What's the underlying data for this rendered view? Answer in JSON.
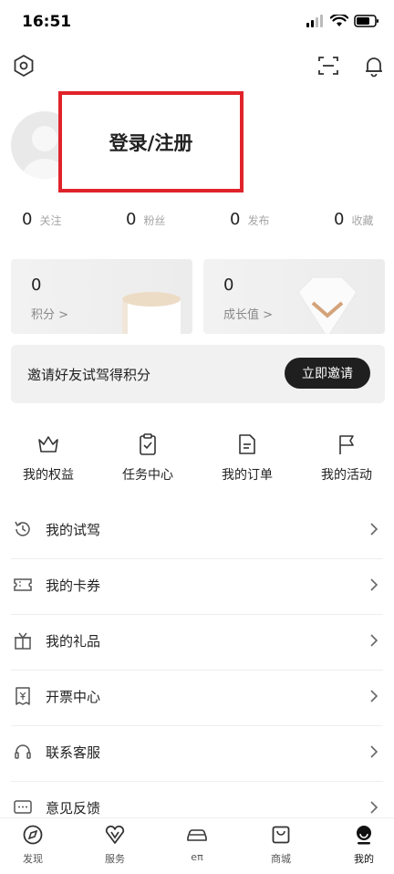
{
  "status_bar": {
    "time": "16:51"
  },
  "profile": {
    "login_label": "登录/注册"
  },
  "stats": [
    {
      "count": "0",
      "label": "关注"
    },
    {
      "count": "0",
      "label": "粉丝"
    },
    {
      "count": "0",
      "label": "发布"
    },
    {
      "count": "0",
      "label": "收藏"
    }
  ],
  "cards": [
    {
      "value": "0",
      "label": "积分 >"
    },
    {
      "value": "0",
      "label": "成长值 >"
    }
  ],
  "invite": {
    "text": "邀请好友试驾得积分",
    "button_label": "立即邀请"
  },
  "quick_actions": [
    {
      "label": "我的权益",
      "icon": "crown-icon"
    },
    {
      "label": "任务中心",
      "icon": "clipboard-check-icon"
    },
    {
      "label": "我的订单",
      "icon": "document-icon"
    },
    {
      "label": "我的活动",
      "icon": "flag-icon"
    }
  ],
  "menu": [
    {
      "label": "我的试驾",
      "icon": "history-icon"
    },
    {
      "label": "我的卡券",
      "icon": "ticket-icon"
    },
    {
      "label": "我的礼品",
      "icon": "gift-icon"
    },
    {
      "label": "开票中心",
      "icon": "invoice-icon"
    },
    {
      "label": "联系客服",
      "icon": "headset-icon"
    },
    {
      "label": "意见反馈",
      "icon": "feedback-icon"
    }
  ],
  "tabbar": [
    {
      "label": "发现",
      "icon": "compass-icon"
    },
    {
      "label": "服务",
      "icon": "heart-v-icon"
    },
    {
      "label": "eπ",
      "icon": "car-icon"
    },
    {
      "label": "商城",
      "icon": "shopping-bag-icon"
    },
    {
      "label": "我的",
      "icon": "profile-icon",
      "active": true
    }
  ],
  "colors": {
    "highlight_border": "#e0232a",
    "invite_button": "#1f1f1f"
  }
}
